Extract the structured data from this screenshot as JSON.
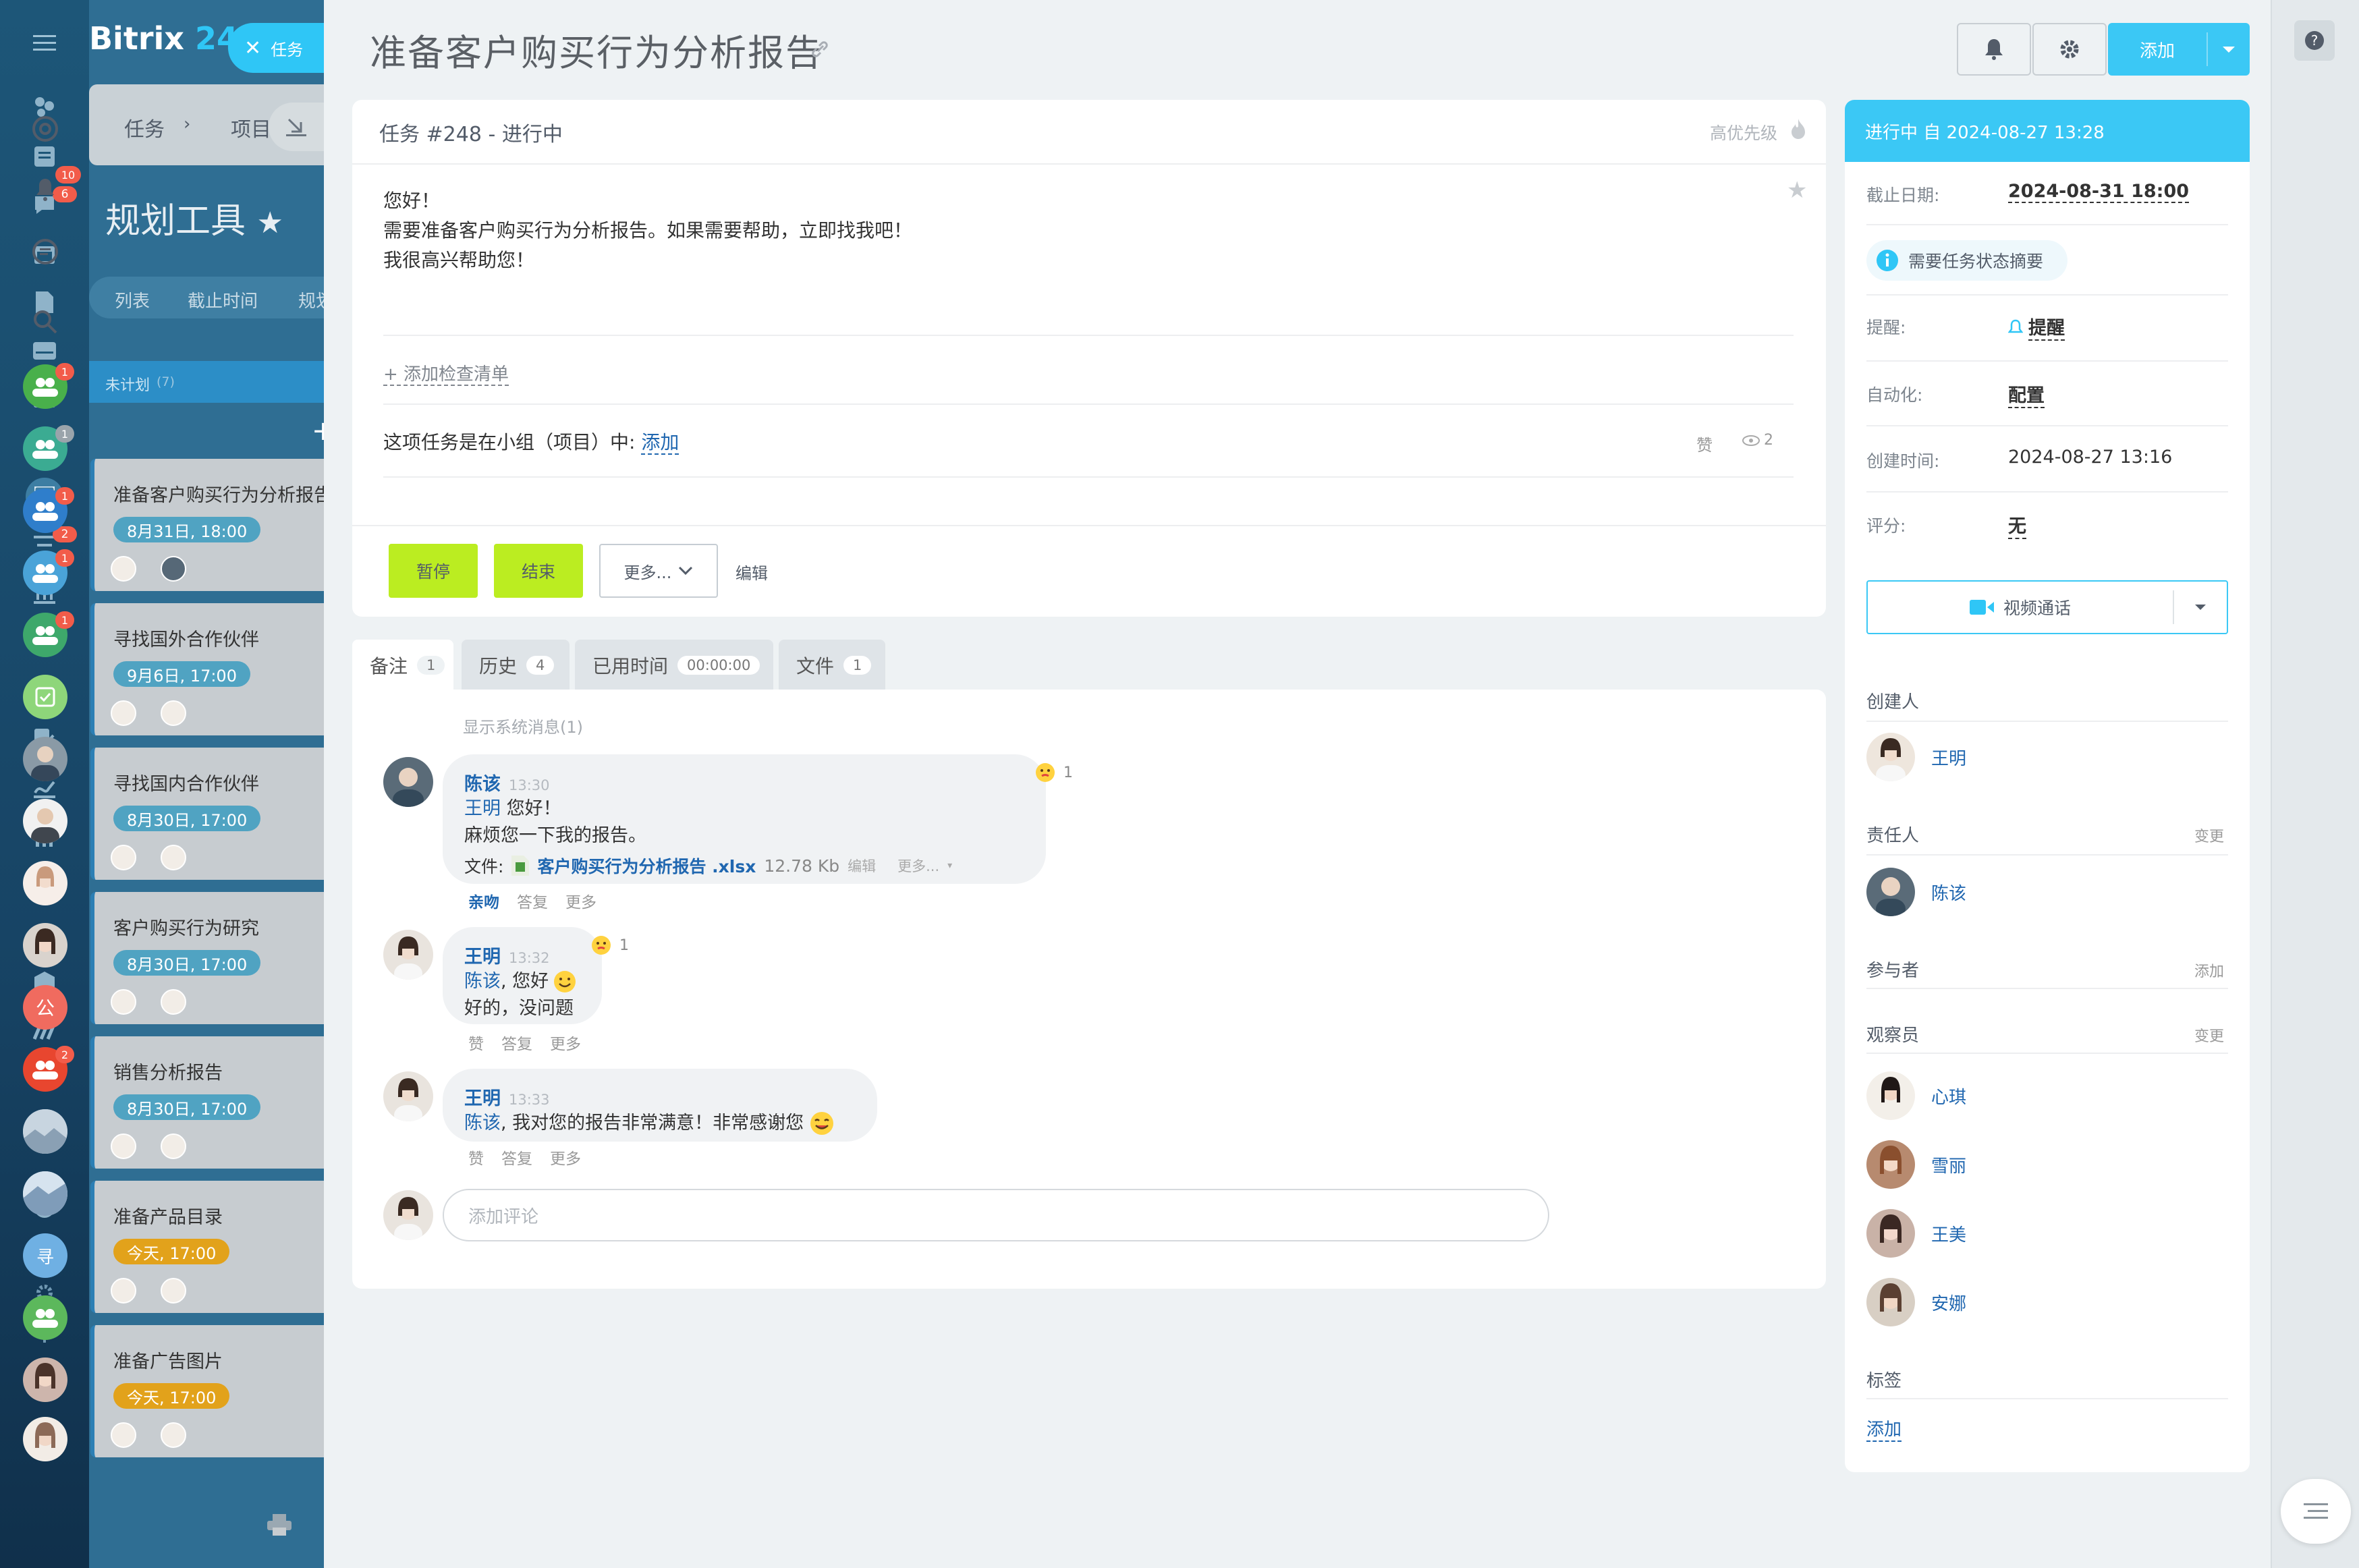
{
  "app": {
    "logo_name": "Bitrix",
    "logo_num": "24"
  },
  "leftbar": {
    "badge_chat": "6",
    "badge_filter": "2"
  },
  "bg": {
    "tab_label": "任务",
    "breadcrumb": [
      "任务",
      "项目"
    ],
    "page_title": "规划工具",
    "views": [
      "列表",
      "截止时间",
      "规划"
    ],
    "column_title": "未计划",
    "column_count": "(7)",
    "cards": [
      {
        "title": "准备客户购买行为分析报告",
        "date": "8月31日, 18:00"
      },
      {
        "title": "寻找国外合作伙伴",
        "date": "9月6日, 17:00"
      },
      {
        "title": "寻找国内合作伙伴",
        "date": "8月30日, 17:00"
      },
      {
        "title": "客户购买行为研究",
        "date": "8月30日, 17:00"
      },
      {
        "title": "销售分析报告",
        "date": "8月30日, 17:00"
      },
      {
        "title": "准备产品目录",
        "date": "今天, 17:00"
      },
      {
        "title": "准备广告图片",
        "date": "今天, 17:00"
      }
    ]
  },
  "task": {
    "title": "准备客户购买行为分析报告",
    "header": "任务 #248 - 进行中",
    "priority": "高优先级",
    "description": [
      "您好！",
      "需要准备客户购买行为分析报告。如果需要帮助，立即找我吧！",
      "我很高兴帮助您！"
    ],
    "add_checklist": "+ 添加检查清单",
    "group_text": "这项任务是在小组（项目）中:",
    "group_add": "添加",
    "like": "赞",
    "views": "2",
    "btn_pause": "暂停",
    "btn_finish": "结束",
    "btn_more": "更多...",
    "btn_edit": "编辑"
  },
  "top": {
    "add_label": "添加"
  },
  "tabs": [
    {
      "label": "备注",
      "count": "1"
    },
    {
      "label": "历史",
      "count": "4"
    },
    {
      "label": "已用时间",
      "count": "00:00:00"
    },
    {
      "label": "文件",
      "count": "1"
    }
  ],
  "comments": {
    "system": "显示系统消息(1)",
    "items": [
      {
        "author": "陈该",
        "time": "13:30",
        "mention": "王明",
        "lines": [
          "您好！",
          "麻烦您一下我的报告。"
        ],
        "file_label": "文件:",
        "file_name": "客户购买行为分析报告 .xlsx",
        "file_size": "12.78 Kb",
        "file_edit": "编辑",
        "file_more": "更多...",
        "reaction": "1",
        "actions": [
          "亲吻",
          "答复",
          "更多"
        ]
      },
      {
        "author": "王明",
        "time": "13:32",
        "mention": "陈该",
        "lines": [
          ", 您好",
          "好的，没问题"
        ],
        "reaction": "1",
        "actions": [
          "赞",
          "答复",
          "更多"
        ]
      },
      {
        "author": "王明",
        "time": "13:33",
        "mention": "陈该",
        "lines": [
          ", 我对您的报告非常满意！非常感谢您"
        ],
        "actions": [
          "赞",
          "答复",
          "更多"
        ]
      }
    ],
    "placeholder": "添加评论"
  },
  "side": {
    "status": "进行中 自 2024-08-27 13:28",
    "deadline_label": "截止日期:",
    "deadline": "2024-08-31 18:00",
    "summary": "需要任务状态摘要",
    "remind_label": "提醒:",
    "remind": "提醒",
    "auto_label": "自动化:",
    "auto": "配置",
    "created_label": "创建时间:",
    "created": "2024-08-27 13:16",
    "rating_label": "评分:",
    "rating": "无",
    "video": "视频通话",
    "creator_label": "创建人",
    "creator": "王明",
    "resp_label": "责任人",
    "resp_change": "变更",
    "resp": "陈该",
    "part_label": "参与者",
    "part_add": "添加",
    "obs_label": "观察员",
    "obs_change": "变更",
    "observers": [
      "心琪",
      "雪丽",
      "王美",
      "安娜"
    ],
    "tags_label": "标签",
    "tags_add": "添加"
  },
  "rightbar": {
    "badge_notify": "10",
    "badges": [
      "1",
      "1",
      "1",
      "1",
      "1",
      "2"
    ],
    "letter1": "公",
    "letter2": "寻"
  },
  "colors": {
    "accent": "#3bc8f5",
    "green": "#bbed21",
    "link": "#2067b0",
    "status": "#3bc8f5"
  }
}
